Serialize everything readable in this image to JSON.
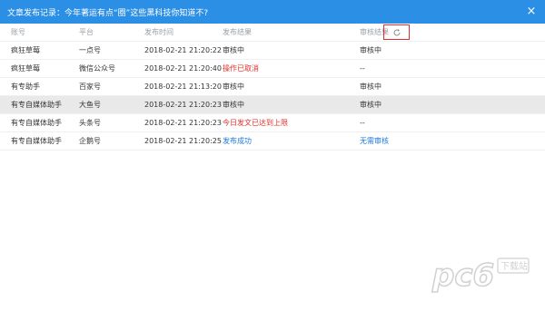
{
  "window": {
    "title": "文章发布记录：今年著运有点“圈”这些黑科技你知道不?",
    "close_label": "×"
  },
  "table": {
    "headers": [
      "账号",
      "平台",
      "发布时间",
      "发布结果",
      "审核结果"
    ],
    "rows": [
      [
        "疯狂草莓",
        "一点号",
        "2018-02-21 21:20:22",
        "审核中",
        "审核中"
      ],
      [
        "疯狂草莓",
        "微信公众号",
        "2018-02-21 21:20:40",
        "操作已取消",
        "--"
      ],
      [
        "有专助手",
        "百家号",
        "2018-02-21 21:13:20",
        "审核中",
        "审核中"
      ],
      [
        "有专自媒体助手",
        "大鱼号",
        "2018-02-21 21:20:23",
        "审核中",
        "审核中"
      ],
      [
        "有专自媒体助手",
        "头条号",
        "2018-02-21 21:20:23",
        "今日发文已达到上限",
        "--"
      ],
      [
        "有专自媒体助手",
        "企鹅号",
        "2018-02-21 21:20:25",
        "发布成功",
        "无需审核"
      ]
    ]
  },
  "colors": {
    "titlebar": "#2b8fe6",
    "error": "#e0302b",
    "success": "#1c7ad9",
    "highlight_row": "#e9e9e9",
    "refresh_box_border": "#e02e2e"
  },
  "icons": {
    "refresh": "refresh-icon",
    "close": "close-icon"
  },
  "watermark": {
    "text": "pc6",
    "sub": "下载站"
  }
}
